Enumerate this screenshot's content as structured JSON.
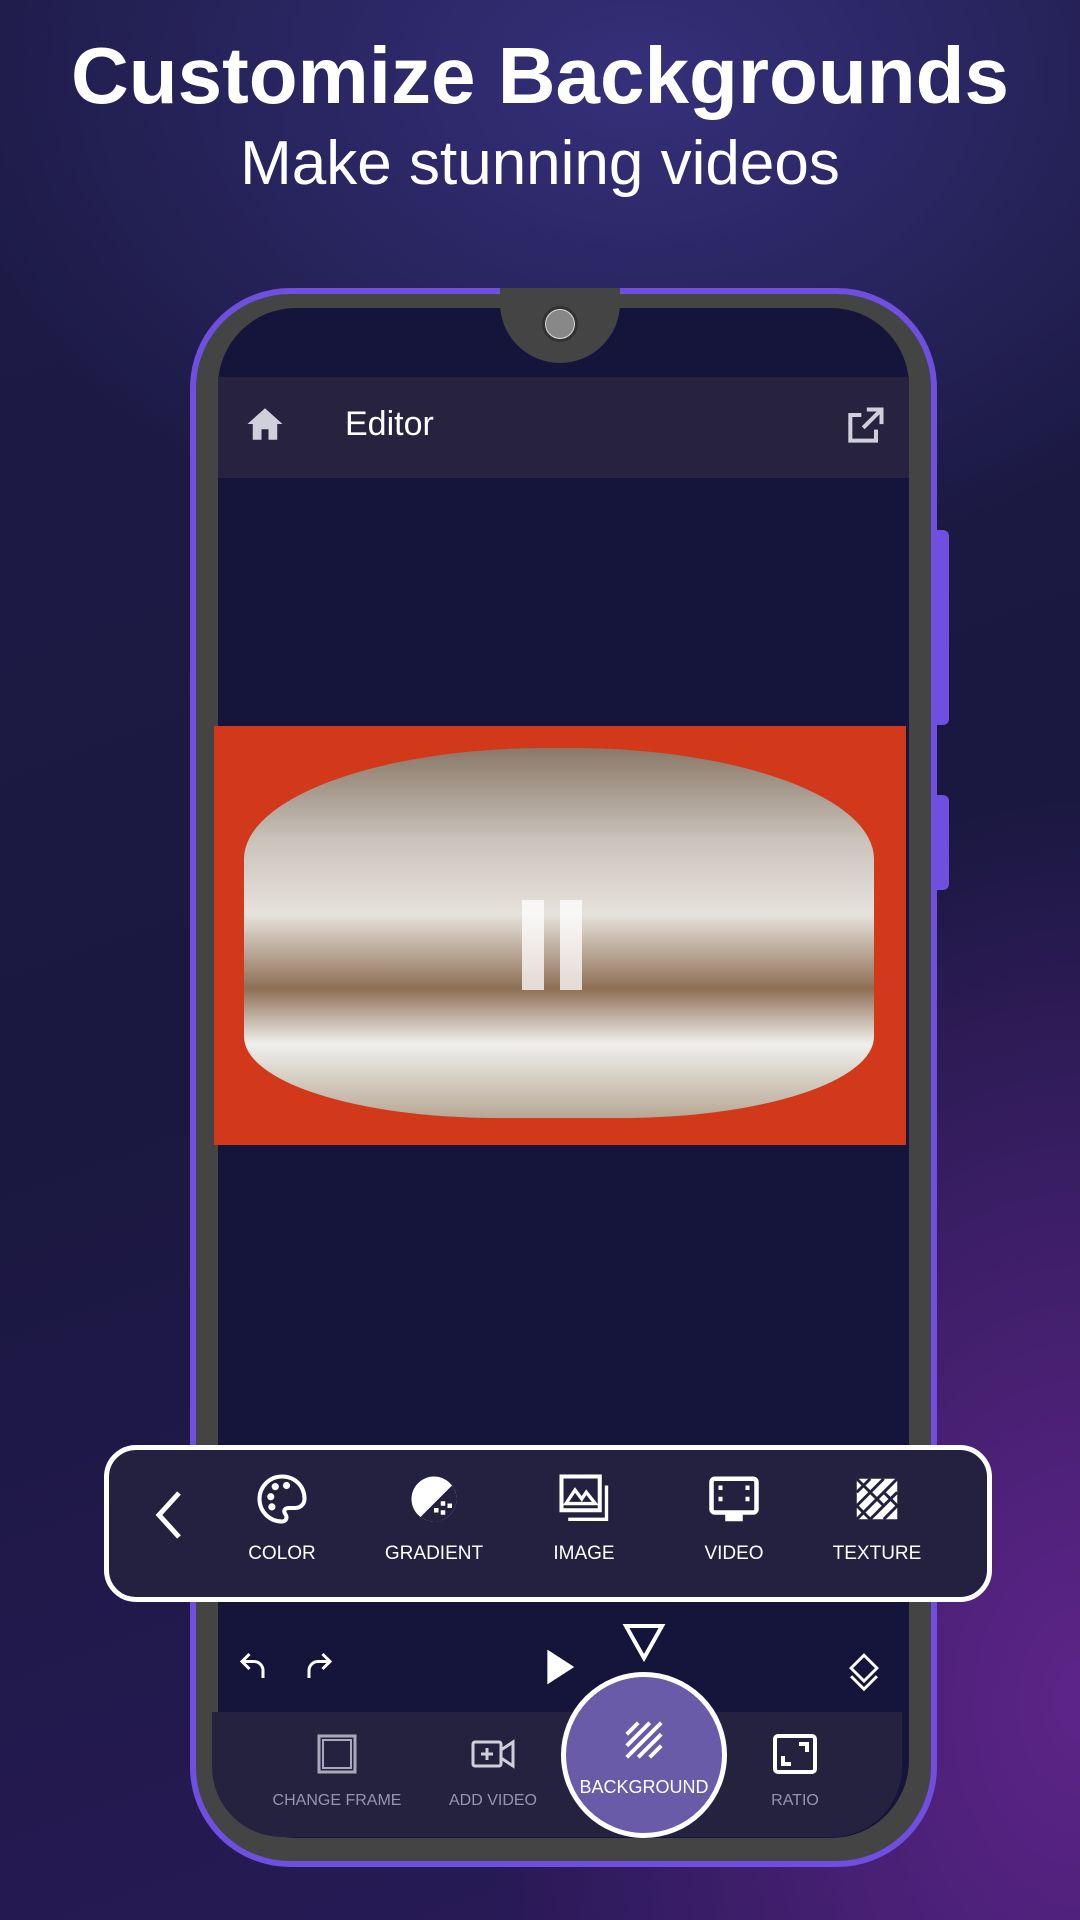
{
  "headline": {
    "title": "Customize Backgrounds",
    "subtitle": "Make stunning videos"
  },
  "app_bar": {
    "title": "Editor",
    "home_icon": "home-icon",
    "share_icon": "open-external-icon"
  },
  "background_panel": {
    "back_icon": "chevron-left-icon",
    "options": [
      {
        "label": "COLOR",
        "icon": "palette-icon"
      },
      {
        "label": "GRADIENT",
        "icon": "gradient-icon"
      },
      {
        "label": "IMAGE",
        "icon": "image-icon"
      },
      {
        "label": "VIDEO",
        "icon": "film-icon"
      },
      {
        "label": "TEXTURE",
        "icon": "texture-icon"
      }
    ]
  },
  "controls": {
    "undo": "undo-icon",
    "redo": "redo-icon",
    "play": "play-icon",
    "layers": "layers-icon"
  },
  "bottom_nav": {
    "items": [
      {
        "label": "CHANGE FRAME"
      },
      {
        "label": "ADD VIDEO"
      },
      {
        "label": "BACKGROUND",
        "active": true
      },
      {
        "label": "RATIO"
      }
    ]
  },
  "colors": {
    "accent": "#6f4fe0",
    "active_button": "#6a5ba8",
    "screen_bg": "#15143a",
    "panel_bg": "#232040"
  }
}
